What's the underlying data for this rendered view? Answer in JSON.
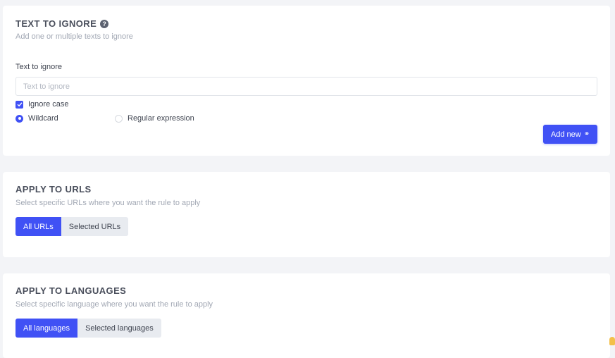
{
  "text_to_ignore": {
    "heading": "TEXT TO IGNORE",
    "help_icon": "question-circle-icon",
    "subtitle": "Add one or multiple texts to ignore",
    "field_label": "Text to ignore",
    "input_placeholder": "Text to ignore",
    "input_value": "",
    "ignore_case_label": "Ignore case",
    "ignore_case_checked": true,
    "match_modes": [
      {
        "label": "Wildcard",
        "selected": true
      },
      {
        "label": "Regular expression",
        "selected": false
      }
    ],
    "add_button_label": "Add new",
    "add_button_icon": "link-icon"
  },
  "apply_to_urls": {
    "heading": "APPLY TO URLS",
    "subtitle": "Select specific URLs where you want the rule to apply",
    "options": [
      {
        "label": "All URLs",
        "active": true
      },
      {
        "label": "Selected URLs",
        "active": false
      }
    ]
  },
  "apply_to_languages": {
    "heading": "APPLY TO LANGUAGES",
    "subtitle": "Select specific language where you want the rule to apply",
    "options": [
      {
        "label": "All languages",
        "active": true
      },
      {
        "label": "Selected languages",
        "active": false
      }
    ]
  },
  "colors": {
    "accent": "#4051f5",
    "background": "#f3f4f7",
    "card": "#ffffff",
    "segment_inactive": "#e8ebf0"
  }
}
